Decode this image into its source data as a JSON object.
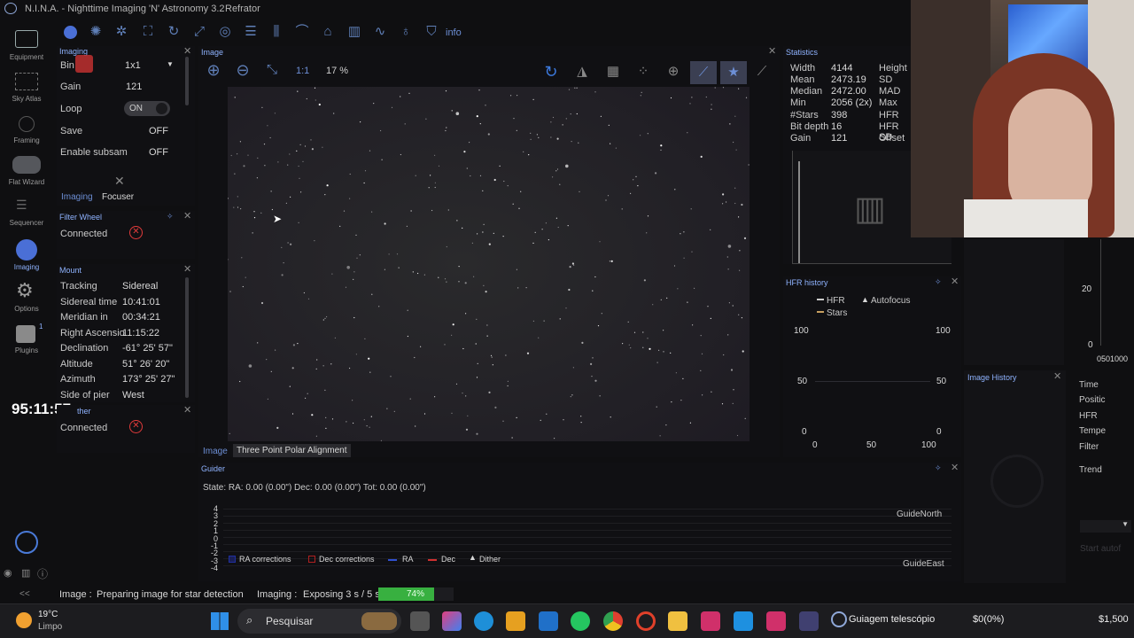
{
  "window": {
    "title": "N.I.N.A. - Nighttime Imaging 'N' Astronomy 3.2",
    "profile": "Refrator"
  },
  "sidebar": {
    "items": [
      {
        "label": "Equipment"
      },
      {
        "label": "Sky Atlas"
      },
      {
        "label": "Framing"
      },
      {
        "label": "Flat Wizard"
      },
      {
        "label": "Sequencer"
      },
      {
        "label": "Imaging"
      },
      {
        "label": "Options"
      },
      {
        "label": "Plugins"
      }
    ],
    "plugin_badge": "1",
    "collapse": "<<"
  },
  "toolbar": {
    "info_label": "info"
  },
  "imaging_panel": {
    "title": "Imaging",
    "bin_label": "Bin",
    "bin_value": "1x1",
    "gain_label": "Gain",
    "gain_value": "121",
    "loop_label": "Loop",
    "loop_value": "ON",
    "save_label": "Save",
    "save_value": "OFF",
    "subsample_label": "Enable subsam",
    "subsample_value": "OFF",
    "tabs": [
      "Imaging",
      "Focuser"
    ]
  },
  "filter_wheel": {
    "title": "Filter Wheel",
    "connected_label": "Connected"
  },
  "mount": {
    "title": "Mount",
    "rows": [
      {
        "label": "Tracking",
        "value": "Sidereal"
      },
      {
        "label": "Sidereal time",
        "value": "10:41:01"
      },
      {
        "label": "Meridian in",
        "value": "00:34:21"
      },
      {
        "label": "Right Ascensio",
        "value": "11:15:22"
      },
      {
        "label": "Declination",
        "value": "-61° 25' 57\""
      },
      {
        "label": "Altitude",
        "value": "51° 26' 20\""
      },
      {
        "label": "Azimuth",
        "value": "173° 25' 27\""
      },
      {
        "label": "Side of pier",
        "value": "West"
      }
    ]
  },
  "weather": {
    "title": "ther",
    "connected_label": "Connected"
  },
  "timer": "95:11:57",
  "image_panel": {
    "title": "Image",
    "zoom_label": "1:1",
    "zoom_value": "17 %",
    "tabs": [
      "Image",
      "Three Point Polar Alignment"
    ]
  },
  "statistics": {
    "title": "Statistics",
    "rows": [
      {
        "label": "Width",
        "value": "4144",
        "label2": "Height"
      },
      {
        "label": "Mean",
        "value": "2473.19",
        "label2": "SD"
      },
      {
        "label": "Median",
        "value": "2472.00",
        "label2": "MAD"
      },
      {
        "label": "Min",
        "value": "2056 (2x)",
        "label2": "Max"
      },
      {
        "label": "#Stars",
        "value": "398",
        "label2": "HFR"
      },
      {
        "label": "Bit depth",
        "value": "16",
        "label2": "HFR SD"
      },
      {
        "label": "Gain",
        "value": "121",
        "label2": "Offset"
      }
    ]
  },
  "hfr_history": {
    "title": "HFR history",
    "legend": [
      "HFR",
      "Autofocus",
      "Stars"
    ],
    "y_left": [
      "100",
      "50",
      "0"
    ],
    "y_right": [
      "100",
      "50",
      "0"
    ],
    "x": [
      "0",
      "50",
      "100"
    ]
  },
  "right_panel": {
    "y_ticks": [
      "20",
      "0"
    ],
    "x_ticks": [
      "0",
      "5",
      "0",
      "1",
      "0",
      "0",
      "0"
    ]
  },
  "image_history": {
    "title": "Image History",
    "columns": [
      "Time",
      "Positic",
      "HFR",
      "Tempe",
      "Filter"
    ],
    "trend_label": "Trend",
    "autofocus_label": "Start autof"
  },
  "guider": {
    "title": "Guider",
    "state": "State:  RA: 0.00 (0.00\")  Dec: 0.00 (0.00\")  Tot: 0.00 (0.00\")",
    "y_ticks": [
      "4",
      "3",
      "2",
      "1",
      "0",
      "-1",
      "-2",
      "-3",
      "-4"
    ],
    "north_label": "GuideNorth",
    "east_label": "GuideEast",
    "legend": [
      {
        "label": "RA corrections",
        "color": "#2030a0"
      },
      {
        "label": "Dec corrections",
        "color": "#b02020"
      },
      {
        "label": "RA",
        "color": "#3050d0"
      },
      {
        "label": "Dec",
        "color": "#d03030"
      },
      {
        "label": "Dither",
        "color": "#e0e0e0"
      }
    ]
  },
  "status_bar": {
    "image_label": "Image :",
    "image_status": "Preparing image for star detection",
    "imaging_label": "Imaging :",
    "imaging_status": "Exposing 3 s / 5 s",
    "progress_text": "74%",
    "progress": 0.74
  },
  "taskbar": {
    "weather_temp": "19°C",
    "weather_desc": "Limpo",
    "search_label": "Pesquisar",
    "active_app": "Guiagem telescópio",
    "price1": "$0(0%)",
    "price2": "$1,500"
  }
}
